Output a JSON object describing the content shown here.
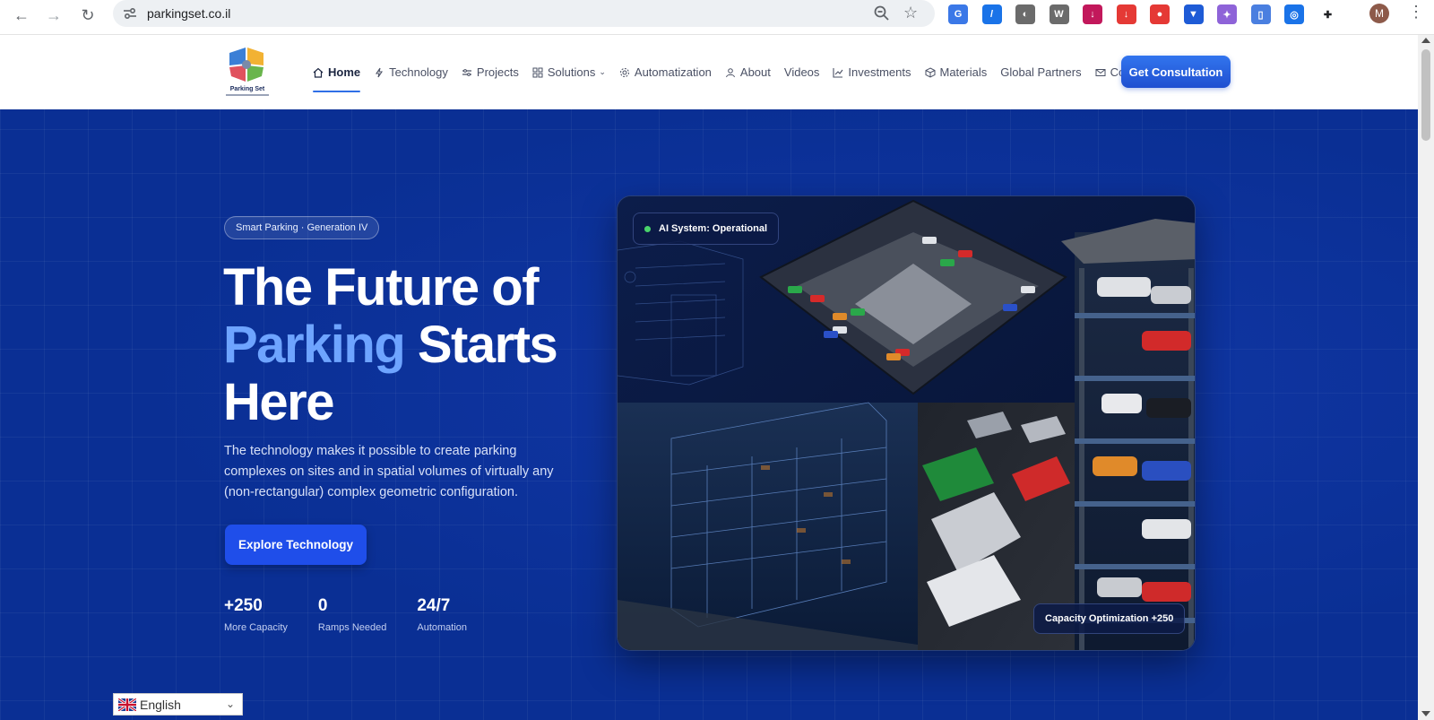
{
  "browser": {
    "url": "parkingset.co.il",
    "profile_initial": "M",
    "extensions": [
      {
        "icon": "translate-icon",
        "color": "#3b78e7",
        "glyph": "G"
      },
      {
        "icon": "pen-icon",
        "color": "#1a73e8",
        "glyph": "/"
      },
      {
        "icon": "circle-extension-icon",
        "color": "#6b6b6b",
        "glyph": "◐"
      },
      {
        "icon": "wordpress-icon",
        "color": "#6b6b6b",
        "glyph": "W"
      },
      {
        "icon": "download-pink-icon",
        "color": "#c2185b",
        "glyph": "↓"
      },
      {
        "icon": "download-red-icon",
        "color": "#e53935",
        "glyph": "↓"
      },
      {
        "icon": "pokeball-icon",
        "color": "#e53935",
        "glyph": "●"
      },
      {
        "icon": "shield-extension-icon",
        "color": "#1e5bd6",
        "glyph": "▼"
      },
      {
        "icon": "purple-extension-icon",
        "color": "#8e63d8",
        "glyph": "✦"
      },
      {
        "icon": "docs-extension-icon",
        "color": "#4a7fe0",
        "glyph": "▯"
      },
      {
        "icon": "screenshot-icon",
        "color": "#1a73e8",
        "glyph": "◎"
      },
      {
        "icon": "puzzle-icon",
        "color": "#202124",
        "glyph": "✚"
      }
    ]
  },
  "header": {
    "logo_text": "Parking Set",
    "nav": [
      {
        "label": "Home",
        "icon": "home-icon",
        "active": true
      },
      {
        "label": "Technology",
        "icon": "bolt-icon"
      },
      {
        "label": "Projects",
        "icon": "sliders-icon"
      },
      {
        "label": "Solutions",
        "icon": "grid-icon",
        "dropdown": true
      },
      {
        "label": "Automatization",
        "icon": "gear-icon"
      },
      {
        "label": "About",
        "icon": "user-icon"
      },
      {
        "label": "Videos",
        "icon": ""
      },
      {
        "label": "Investments",
        "icon": "chart-icon"
      },
      {
        "label": "Materials",
        "icon": "box-icon"
      },
      {
        "label": "Global Partners",
        "icon": ""
      },
      {
        "label": "Contact",
        "icon": "mail-icon"
      }
    ],
    "cta": "Get Consultation"
  },
  "hero": {
    "badge": "Smart Parking · Generation IV",
    "headline_1": "The Future of",
    "headline_accent": "Parking",
    "headline_2": "Starts",
    "headline_3": "Here",
    "lead": "The technology makes it possible to create parking complexes on sites and in spatial volumes of virtually any (non-rectangular) complex geometric configuration.",
    "button": "Explore Technology",
    "stats": [
      {
        "value": "+250",
        "label": "More Capacity"
      },
      {
        "value": "0",
        "label": "Ramps Needed"
      },
      {
        "value": "24/7",
        "label": "Automation"
      }
    ],
    "status_pill": "AI System: Operational",
    "capacity_pill": "Capacity Optimization +250"
  },
  "language": {
    "selected": "English"
  }
}
